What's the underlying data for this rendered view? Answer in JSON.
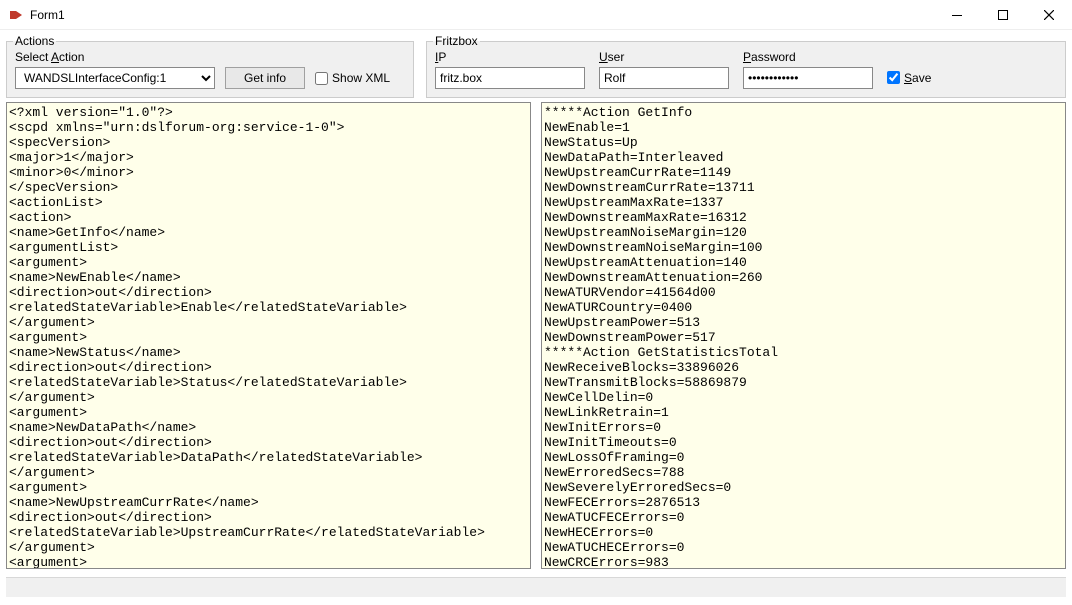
{
  "window": {
    "title": "Form1"
  },
  "actions": {
    "groupTitle": "Actions",
    "selectLabelPrefix": "Select ",
    "selectLabelAccel": "A",
    "selectLabelSuffix": "ction",
    "comboValue": "WANDSLInterfaceConfig:1",
    "getInfoLabel": "Get info",
    "showXmlLabel": "Show XML",
    "showXmlChecked": false
  },
  "fritzbox": {
    "groupTitle": "Fritzbox",
    "ip": {
      "label": "IP",
      "accel": "I",
      "rest": "P",
      "value": "fritz.box"
    },
    "user": {
      "label": "User",
      "accel": "U",
      "rest": "ser",
      "value": "Rolf"
    },
    "password": {
      "label": "Password",
      "accel": "P",
      "rest": "assword",
      "value": "************"
    },
    "save": {
      "label": "Save",
      "accel": "S",
      "rest": "ave",
      "checked": true
    }
  },
  "leftPane": "<?xml version=\"1.0\"?>\n<scpd xmlns=\"urn:dslforum-org:service-1-0\">\n<specVersion>\n<major>1</major>\n<minor>0</minor>\n</specVersion>\n<actionList>\n<action>\n<name>GetInfo</name>\n<argumentList>\n<argument>\n<name>NewEnable</name>\n<direction>out</direction>\n<relatedStateVariable>Enable</relatedStateVariable>\n</argument>\n<argument>\n<name>NewStatus</name>\n<direction>out</direction>\n<relatedStateVariable>Status</relatedStateVariable>\n</argument>\n<argument>\n<name>NewDataPath</name>\n<direction>out</direction>\n<relatedStateVariable>DataPath</relatedStateVariable>\n</argument>\n<argument>\n<name>NewUpstreamCurrRate</name>\n<direction>out</direction>\n<relatedStateVariable>UpstreamCurrRate</relatedStateVariable>\n</argument>\n<argument>\n",
  "rightPane": "*****Action GetInfo\nNewEnable=1\nNewStatus=Up\nNewDataPath=Interleaved\nNewUpstreamCurrRate=1149\nNewDownstreamCurrRate=13711\nNewUpstreamMaxRate=1337\nNewDownstreamMaxRate=16312\nNewUpstreamNoiseMargin=120\nNewDownstreamNoiseMargin=100\nNewUpstreamAttenuation=140\nNewDownstreamAttenuation=260\nNewATURVendor=41564d00\nNewATURCountry=0400\nNewUpstreamPower=513\nNewDownstreamPower=517\n*****Action GetStatisticsTotal\nNewReceiveBlocks=33896026\nNewTransmitBlocks=58869879\nNewCellDelin=0\nNewLinkRetrain=1\nNewInitErrors=0\nNewInitTimeouts=0\nNewLossOfFraming=0\nNewErroredSecs=788\nNewSeverelyErroredSecs=0\nNewFECErrors=2876513\nNewATUCFECErrors=0\nNewHECErrors=0\nNewATUCHECErrors=0\nNewCRCErrors=983\n"
}
